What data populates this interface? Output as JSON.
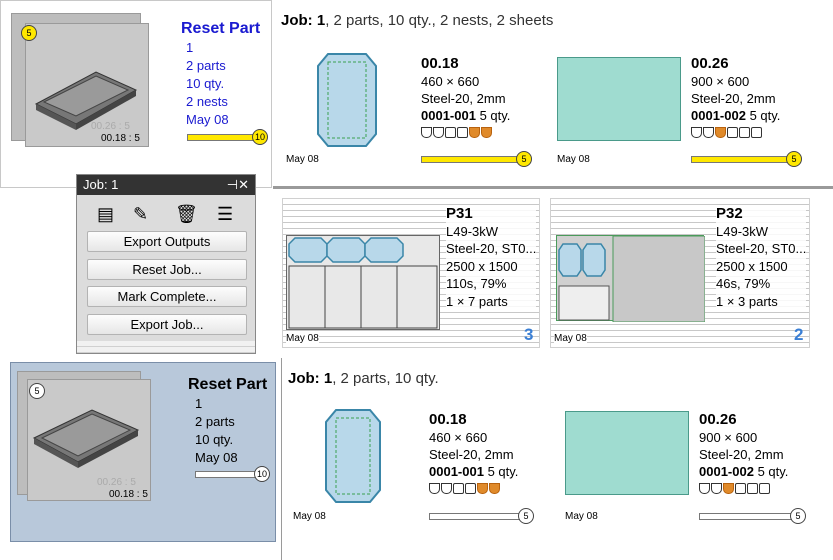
{
  "top_part": {
    "badge": "5",
    "thumb_label": "00.18 : 5",
    "thumb_faint": "00.26 : 5",
    "title": "Reset Part",
    "lines": [
      "1",
      "2 parts",
      "10 qty.",
      "2 nests",
      "May 08"
    ],
    "progress_badge": "10",
    "progress": 1.0
  },
  "bottom_part": {
    "badge": "5",
    "thumb_label": "00.18 : 5",
    "thumb_faint": "00.26 : 5",
    "title": "Reset Part",
    "lines": [
      "1",
      "2 parts",
      "10 qty.",
      "May 08"
    ],
    "progress_badge": "10",
    "progress": 0.0
  },
  "top_job": {
    "label": "Job:",
    "number": "1",
    "summary": ", 2 parts, 10 qty., 2 nests, 2 sheets",
    "parts": [
      {
        "name": "00.18",
        "size": "460 × 660",
        "material": "Steel-20, 2mm",
        "code": "0001-001",
        "qty": " 5 qty.",
        "date": "May 08",
        "badge": "5",
        "progress": 1.0
      },
      {
        "name": "00.26",
        "size": "900 × 600",
        "material": "Steel-20, 2mm",
        "code": "0001-002",
        "qty": " 5 qty.",
        "date": "May 08",
        "badge": "5",
        "progress": 1.0
      }
    ]
  },
  "nests": [
    {
      "name": "P31",
      "machine": "L49-3kW",
      "material": "Steel-20, ST0...",
      "sheet": "2500 x 1500",
      "time": "110s, 79%",
      "parts": "1 × 7 parts",
      "date": "May 08",
      "count": "3"
    },
    {
      "name": "P32",
      "machine": "L49-3kW",
      "material": "Steel-20, ST0...",
      "sheet": "2500 x 1500",
      "time": "46s, 79%",
      "parts": "1 × 3 parts",
      "date": "May 08",
      "count": "2"
    }
  ],
  "bottom_job": {
    "label": "Job:",
    "number": "1",
    "summary": ", 2 parts, 10 qty.",
    "parts": [
      {
        "name": "00.18",
        "size": "460 × 660",
        "material": "Steel-20, 2mm",
        "code": "0001-001",
        "qty": " 5 qty.",
        "date": "May 08",
        "badge": "5",
        "progress": 0.0
      },
      {
        "name": "00.26",
        "size": "900 × 600",
        "material": "Steel-20, 2mm",
        "code": "0001-002",
        "qty": " 5 qty.",
        "date": "May 08",
        "badge": "5",
        "progress": 0.0
      }
    ]
  },
  "panel": {
    "title": "Job: 1",
    "pin": "⊣✕",
    "buttons": [
      "Export Outputs",
      "Reset Job...",
      "Mark Complete...",
      "Export Job..."
    ],
    "tool_icons": [
      "document-icon",
      "edit-document-icon",
      "trash-icon",
      "report-icon"
    ]
  },
  "colors": {
    "accent_blue": "#1a1ad0",
    "progress_yellow": "#ffe800",
    "sheet_teal": "#9fdcd0",
    "part_blue": "#b8d8ea",
    "count_blue": "#3a7fd5"
  }
}
